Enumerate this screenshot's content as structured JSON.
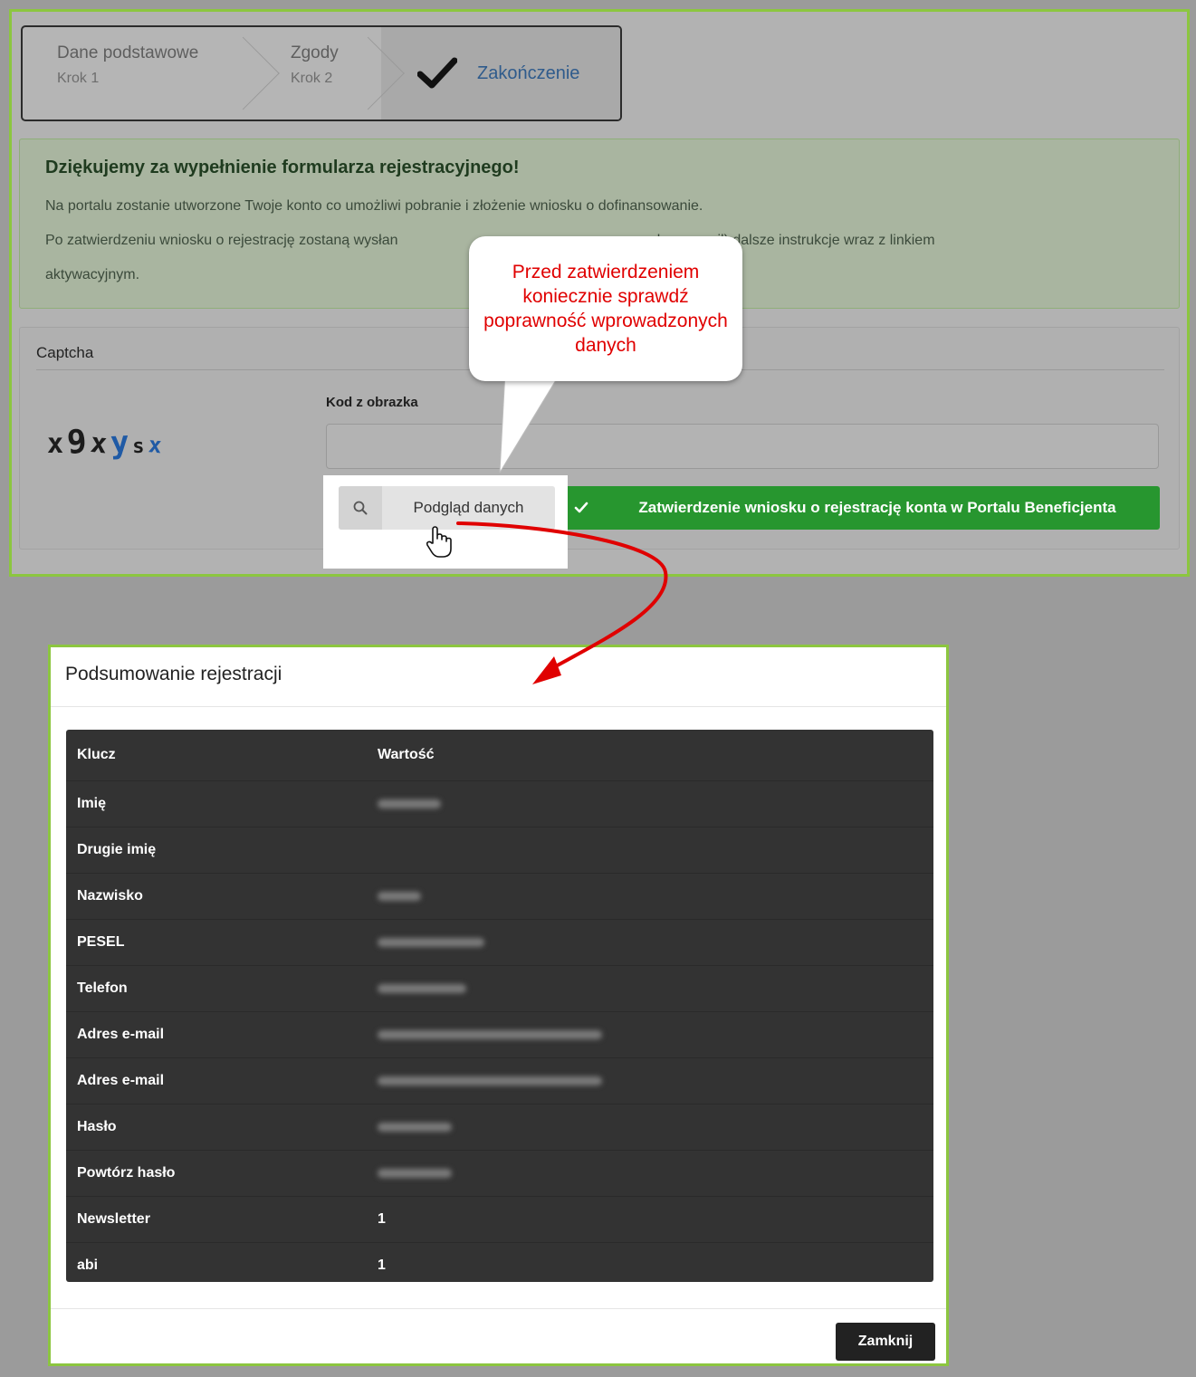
{
  "stepper": {
    "steps": [
      {
        "title": "Dane podstawowe",
        "sub": "Krok 1"
      },
      {
        "title": "Zgody",
        "sub": "Krok 2"
      },
      {
        "title": "Zakończenie"
      }
    ]
  },
  "alert": {
    "title": "Dziękujemy za wypełnienie formularza rejestracyjnego!",
    "line1": "Na portalu zostanie utworzone Twoje konto co umożliwi pobranie i złożenie wniosku o dofinansowanie.",
    "line2_start": "Po zatwierdzeniu wniosku o rejestrację zostaną wysłan",
    "line2_end": "adres e-mail) dalsze instrukcje wraz z linkiem",
    "line3": "aktywacyjnym."
  },
  "captcha": {
    "panel_title": "Captcha",
    "chars": [
      {
        "ch": "x",
        "color": "#1c1c1c"
      },
      {
        "ch": "9",
        "color": "#1c1c1c"
      },
      {
        "ch": "x",
        "color": "#1c1c1c"
      },
      {
        "ch": "y",
        "color": "#1f5aa5"
      },
      {
        "ch": "s",
        "color": "#1c1c1c"
      },
      {
        "ch": "x",
        "color": "#1f5aa5"
      }
    ],
    "code_label": "Kod z obrazka",
    "code_value": ""
  },
  "buttons": {
    "preview_label": "Podgląd danych",
    "confirm_label": "Zatwierdzenie wniosku o rejestrację konta w Portalu Beneficjenta"
  },
  "callout": {
    "text": "Przed zatwierdzeniem koniecznie sprawdź poprawność wprowadzonych danych"
  },
  "modal": {
    "title": "Podsumowanie rejestracji",
    "col_key": "Klucz",
    "col_value": "Wartość",
    "rows": [
      {
        "key": "Imię",
        "value": "",
        "blurred": true
      },
      {
        "key": "Drugie imię",
        "value": "",
        "blurred": false
      },
      {
        "key": "Nazwisko",
        "value": "",
        "blurred": true
      },
      {
        "key": "PESEL",
        "value": "",
        "blurred": true
      },
      {
        "key": "Telefon",
        "value": "",
        "blurred": true
      },
      {
        "key": "Adres e-mail",
        "value": "",
        "blurred": true
      },
      {
        "key": "Adres e-mail",
        "value": "",
        "blurred": true
      },
      {
        "key": "Hasło",
        "value": "",
        "blurred": true
      },
      {
        "key": "Powtórz hasło",
        "value": "",
        "blurred": true
      },
      {
        "key": "Newsletter",
        "value": "1",
        "blurred": false
      },
      {
        "key": "abi",
        "value": "1",
        "blurred": false
      }
    ],
    "close_label": "Zamknij"
  },
  "colors": {
    "accent_green": "#8cc63f",
    "confirm_green": "#27962f",
    "callout_red": "#e00000",
    "step_active": "#2f5b8c"
  }
}
